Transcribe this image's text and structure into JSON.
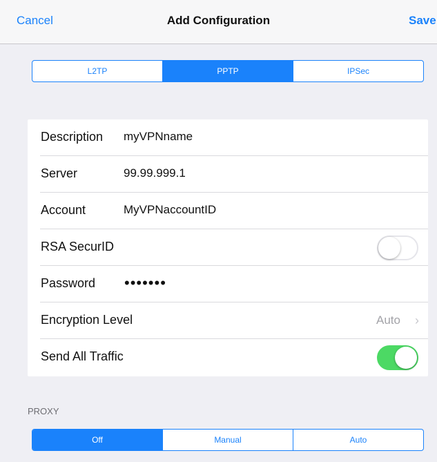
{
  "nav": {
    "cancel": "Cancel",
    "title": "Add Configuration",
    "save": "Save"
  },
  "vpn_type": {
    "options": [
      "L2TP",
      "PPTP",
      "IPSec"
    ],
    "selected": "PPTP"
  },
  "fields": {
    "description": {
      "label": "Description",
      "value": "myVPNname"
    },
    "server": {
      "label": "Server",
      "value": "99.99.999.1"
    },
    "account": {
      "label": "Account",
      "value": "MyVPNaccountID"
    },
    "rsa": {
      "label": "RSA SecurID",
      "on": false
    },
    "password": {
      "label": "Password",
      "masked": "•••••••"
    },
    "encryption": {
      "label": "Encryption Level",
      "value": "Auto",
      "chevron": "›"
    },
    "send_all": {
      "label": "Send All Traffic",
      "on": true
    }
  },
  "proxy": {
    "header": "PROXY",
    "options": [
      "Off",
      "Manual",
      "Auto"
    ],
    "selected": "Off"
  },
  "colors": {
    "accent": "#1a82fb",
    "toggle_on": "#4cd964",
    "background": "#efeff4"
  }
}
